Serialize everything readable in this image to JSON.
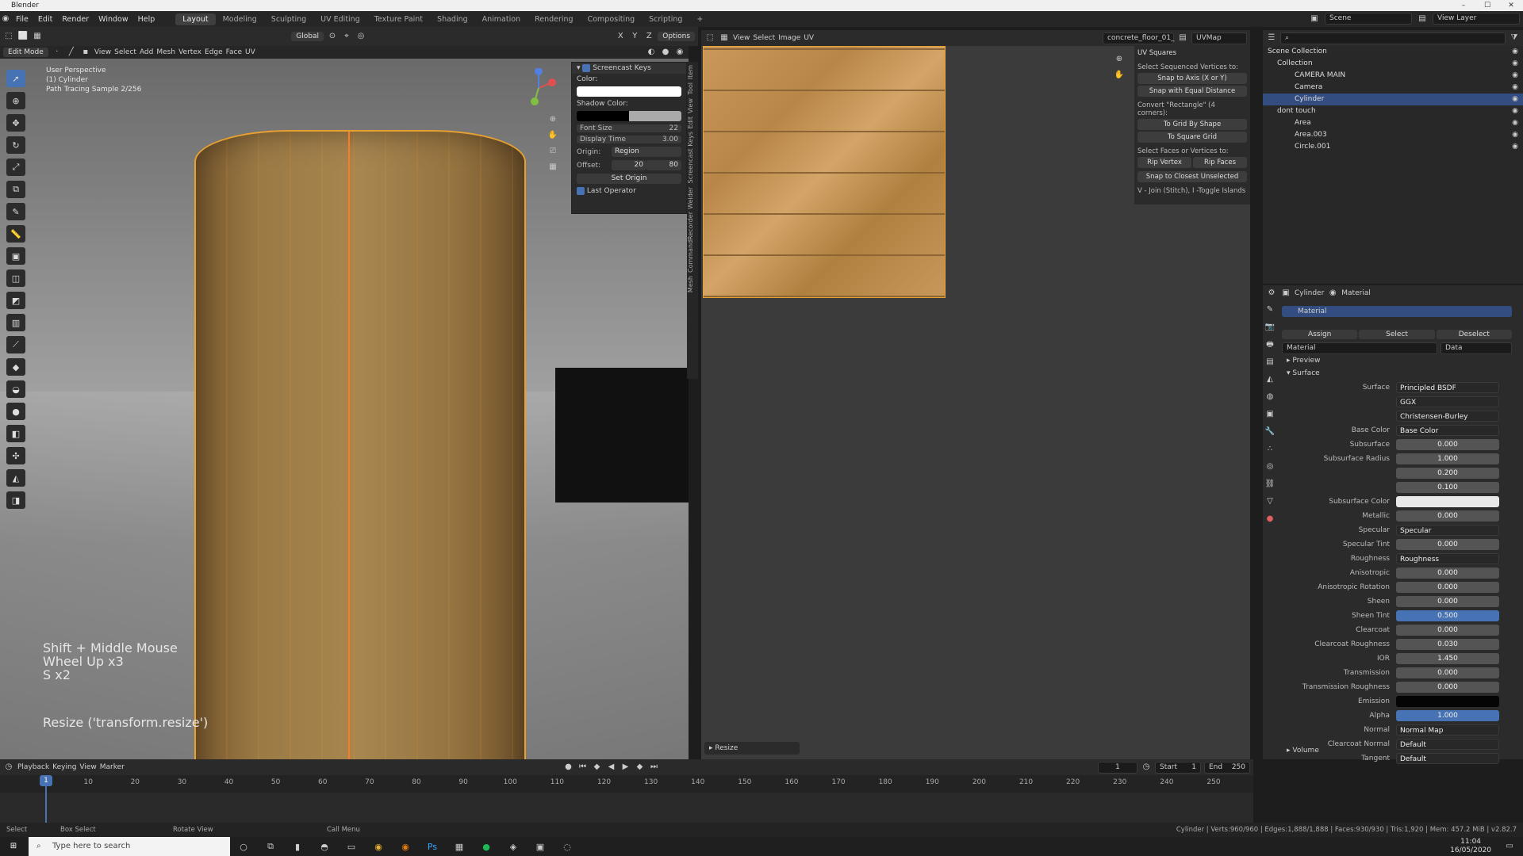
{
  "app_title": "Blender",
  "menu": [
    "File",
    "Edit",
    "Render",
    "Window",
    "Help"
  ],
  "workspaces": [
    "Layout",
    "Modeling",
    "Sculpting",
    "UV Editing",
    "Texture Paint",
    "Shading",
    "Animation",
    "Rendering",
    "Compositing",
    "Scripting"
  ],
  "active_workspace": "Layout",
  "scene_name": "Scene",
  "view_layer": "View Layer",
  "viewport": {
    "mode": "Edit Mode",
    "menus": [
      "View",
      "Select",
      "Add",
      "Mesh",
      "Vertex",
      "Edge",
      "Face",
      "UV"
    ],
    "transform": "Global",
    "options": "Options",
    "info_line1": "User Perspective",
    "info_line2": "(1) Cylinder",
    "info_line3": "Path Tracing Sample 2/256",
    "keys_line1": "Shift + Middle Mouse",
    "keys_line2": "Wheel Up x3",
    "keys_line3": "S x2",
    "operator_text": "Resize ('transform.resize')"
  },
  "screencast": {
    "title": "Screencast Keys",
    "color_label": "Color:",
    "shadow_label": "Shadow Color:",
    "font_size_label": "Font Size",
    "font_size": "22",
    "display_time_label": "Display Time",
    "display_time": "3.00",
    "origin_label": "Origin:",
    "origin": "Region",
    "offset_label": "Offset:",
    "offset_x": "20",
    "offset_y": "80",
    "set_origin": "Set Origin",
    "last_operator": "Last Operator"
  },
  "side_tabs": [
    "Item",
    "Tool",
    "View",
    "Edit",
    "Screencast Keys",
    "Weider",
    "CommandRecorder",
    "Mesh"
  ],
  "uv_editor": {
    "menus": [
      "View",
      "Select",
      "Image",
      "UV"
    ],
    "image": "concrete_floor_01_",
    "uvmap": "UVMap",
    "last_op": "Resize"
  },
  "uv_squares": {
    "title": "UV Squares",
    "sel_seq": "Select Sequenced Vertices to:",
    "snap_axis": "Snap to Axis (X or Y)",
    "snap_equal": "Snap with Equal Distance",
    "convert": "Convert \"Rectangle\" (4 corners):",
    "grid_shape": "To Grid By Shape",
    "square_grid": "To Square Grid",
    "sel_faces": "Select Faces or Vertices to:",
    "rip_vertex": "Rip Vertex",
    "rip_faces": "Rip Faces",
    "snap_closest": "Snap to Closest Unselected",
    "hint": "V - Join (Stitch), I -Toggle Islands"
  },
  "outliner": [
    {
      "name": "Scene Collection",
      "ind": 6
    },
    {
      "name": "Collection",
      "ind": 18
    },
    {
      "name": "CAMERA MAIN",
      "ind": 40
    },
    {
      "name": "Camera",
      "ind": 40
    },
    {
      "name": "Cylinder",
      "ind": 40,
      "sel": true
    },
    {
      "name": "dont touch",
      "ind": 18
    },
    {
      "name": "Area",
      "ind": 40
    },
    {
      "name": "Area.003",
      "ind": 40
    },
    {
      "name": "Circle.001",
      "ind": 40
    }
  ],
  "properties": {
    "object": "Cylinder",
    "material_tab": "Material",
    "slot": "Material",
    "assign": "Assign",
    "select": "Select",
    "deselect": "Deselect",
    "mat_name": "Material",
    "data": "Data",
    "preview": "Preview",
    "surface_hdr": "Surface",
    "volume": "Volume",
    "rows": [
      {
        "label": "Surface",
        "value": "Principled BSDF",
        "kind": "dd"
      },
      {
        "label": "",
        "value": "GGX",
        "kind": "dd"
      },
      {
        "label": "",
        "value": "Christensen-Burley",
        "kind": "dd"
      },
      {
        "label": "Base Color",
        "value": "Base Color",
        "kind": "dd"
      },
      {
        "label": "Subsurface",
        "value": "0.000",
        "kind": "num"
      },
      {
        "label": "Subsurface Radius",
        "value": "1.000",
        "kind": "num"
      },
      {
        "label": "",
        "value": "0.200",
        "kind": "num"
      },
      {
        "label": "",
        "value": "0.100",
        "kind": "num"
      },
      {
        "label": "Subsurface Color",
        "value": "",
        "kind": "white"
      },
      {
        "label": "Metallic",
        "value": "0.000",
        "kind": "num"
      },
      {
        "label": "Specular",
        "value": "Specular",
        "kind": "dd"
      },
      {
        "label": "Specular Tint",
        "value": "0.000",
        "kind": "num"
      },
      {
        "label": "Roughness",
        "value": "Roughness",
        "kind": "dd"
      },
      {
        "label": "Anisotropic",
        "value": "0.000",
        "kind": "num"
      },
      {
        "label": "Anisotropic Rotation",
        "value": "0.000",
        "kind": "num"
      },
      {
        "label": "Sheen",
        "value": "0.000",
        "kind": "num"
      },
      {
        "label": "Sheen Tint",
        "value": "0.500",
        "kind": "blue"
      },
      {
        "label": "Clearcoat",
        "value": "0.000",
        "kind": "num"
      },
      {
        "label": "Clearcoat Roughness",
        "value": "0.030",
        "kind": "num"
      },
      {
        "label": "IOR",
        "value": "1.450",
        "kind": "num"
      },
      {
        "label": "Transmission",
        "value": "0.000",
        "kind": "num"
      },
      {
        "label": "Transmission Roughness",
        "value": "0.000",
        "kind": "num"
      },
      {
        "label": "Emission",
        "value": "",
        "kind": "black"
      },
      {
        "label": "Alpha",
        "value": "1.000",
        "kind": "blue"
      },
      {
        "label": "Normal",
        "value": "Normal Map",
        "kind": "dd"
      },
      {
        "label": "Clearcoat Normal",
        "value": "Default",
        "kind": "dd"
      },
      {
        "label": "Tangent",
        "value": "Default",
        "kind": "dd"
      }
    ]
  },
  "timeline": {
    "menus": [
      "Playback",
      "Keying",
      "View",
      "Marker"
    ],
    "frame": "1",
    "start_label": "Start",
    "start": "1",
    "end_label": "End",
    "end": "250",
    "ticks": [
      "1",
      "10",
      "20",
      "30",
      "40",
      "50",
      "60",
      "70",
      "80",
      "90",
      "100",
      "110",
      "120",
      "130",
      "140",
      "150",
      "160",
      "170",
      "180",
      "190",
      "200",
      "210",
      "220",
      "230",
      "240",
      "250"
    ]
  },
  "status": {
    "select": "Select",
    "box": "Box Select",
    "rotate": "Rotate View",
    "call": "Call Menu",
    "stats": "Cylinder | Verts:960/960 | Edges:1,888/1,888 | Faces:930/930 | Tris:1,920 | Mem: 457.2 MiB | v2.82.7"
  },
  "taskbar": {
    "search": "Type here to search",
    "time": "11:04",
    "date": "16/05/2020"
  }
}
